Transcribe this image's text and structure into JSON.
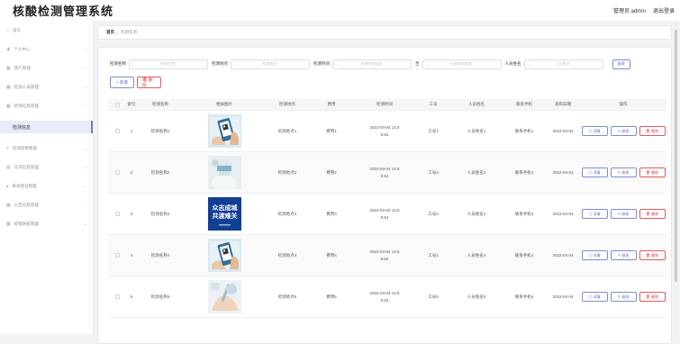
{
  "app": {
    "title": "核酸检测管理系统"
  },
  "topbar": {
    "role_user": "管理员 admin",
    "logout": "退出登录"
  },
  "sidebar": {
    "items": [
      {
        "icon": "home-icon",
        "glyph": "⌂",
        "label": "首页",
        "chev": ""
      },
      {
        "icon": "user-icon",
        "glyph": "♟",
        "label": "个人中心",
        "chev": "⌄"
      },
      {
        "icon": "grid-icon",
        "glyph": "▦",
        "label": "用户管理",
        "chev": "⌄"
      },
      {
        "icon": "grid-icon",
        "glyph": "▦",
        "label": "检测人员管理",
        "chev": "⌄"
      },
      {
        "icon": "grid-icon",
        "glyph": "▦",
        "label": "检测信息管理",
        "chev": "⌃"
      },
      {
        "icon": "list-icon",
        "glyph": "≡",
        "label": "检测结果管理",
        "chev": "⌄"
      },
      {
        "icon": "book-icon",
        "glyph": "▤",
        "label": "实况信息管理",
        "chev": "⌄"
      },
      {
        "icon": "chart-icon",
        "glyph": "▴",
        "label": "来访登记管理",
        "chev": "⌄"
      },
      {
        "icon": "grid-icon",
        "glyph": "▦",
        "label": "公告信息管理",
        "chev": "⌄"
      },
      {
        "icon": "grid-icon",
        "glyph": "▦",
        "label": "疫情防疫管理",
        "chev": "⌄"
      }
    ],
    "active_sub": "检测信息"
  },
  "breadcrumb": {
    "home": "首页",
    "sep": "/",
    "current": "检测信息"
  },
  "search": {
    "fields": [
      {
        "label": "检测名称",
        "placeholder": "检测名称"
      },
      {
        "label": "检测地点",
        "placeholder": "检测地点"
      },
      {
        "label": "检测时间",
        "placeholder": "检测时间起始"
      },
      {
        "label": "至",
        "placeholder": "检测时间结束"
      },
      {
        "label": "人员姓名",
        "placeholder": "人员姓名"
      }
    ],
    "query_label": "查询"
  },
  "actions": {
    "add": "+ 新增",
    "delete": "🗑 删除"
  },
  "table": {
    "headers": [
      "",
      "索引",
      "检测名称",
      "相关图片",
      "检测地点",
      "费用",
      "检测时间",
      "工号",
      "人员姓名",
      "联系手机",
      "发布日期",
      "操作"
    ],
    "rows": [
      {
        "idx": "1",
        "name": "检测名称1",
        "place": "检测地点1",
        "fee": "费用1",
        "time1": "2022-04-04 14:5",
        "time2": "5:54",
        "no": "工号1",
        "person": "人员姓名1",
        "phone": "联系手机1",
        "date": "2022-04-04",
        "img": "phone-qr"
      },
      {
        "idx": "2",
        "name": "检测名称2",
        "place": "检测地点2",
        "fee": "费用2",
        "time1": "2022-04-04 14:5",
        "time2": "5:54",
        "no": "工号2",
        "person": "人员姓名2",
        "phone": "联系手机2",
        "date": "2022-04-04",
        "img": "medic"
      },
      {
        "idx": "3",
        "name": "检测名称3",
        "place": "检测地点3",
        "fee": "费用3",
        "time1": "2022-04-04 14:5",
        "time2": "5:54",
        "no": "工号3",
        "person": "人员姓名3",
        "phone": "联系手机3",
        "date": "2022-04-04",
        "img": "poster",
        "poster_line1": "众志成城",
        "poster_line2": "共渡难关"
      },
      {
        "idx": "4",
        "name": "检测名称4",
        "place": "检测地点4",
        "fee": "费用4",
        "time1": "2022-04-04 14:5",
        "time2": "5:54",
        "no": "工号4",
        "person": "人员姓名4",
        "phone": "联系手机4",
        "date": "2022-04-04",
        "img": "phone-qr"
      },
      {
        "idx": "5",
        "name": "检测名称5",
        "place": "检测地点5",
        "fee": "费用5",
        "time1": "2022-04-04 14:5",
        "time2": "5:54",
        "no": "工号5",
        "person": "人员姓名5",
        "phone": "联系手机5",
        "date": "2022-04-04",
        "img": "swab"
      }
    ],
    "op_detail": "▤ 详情",
    "op_edit": "✎ 修改",
    "op_delete": "🗑 删除"
  }
}
